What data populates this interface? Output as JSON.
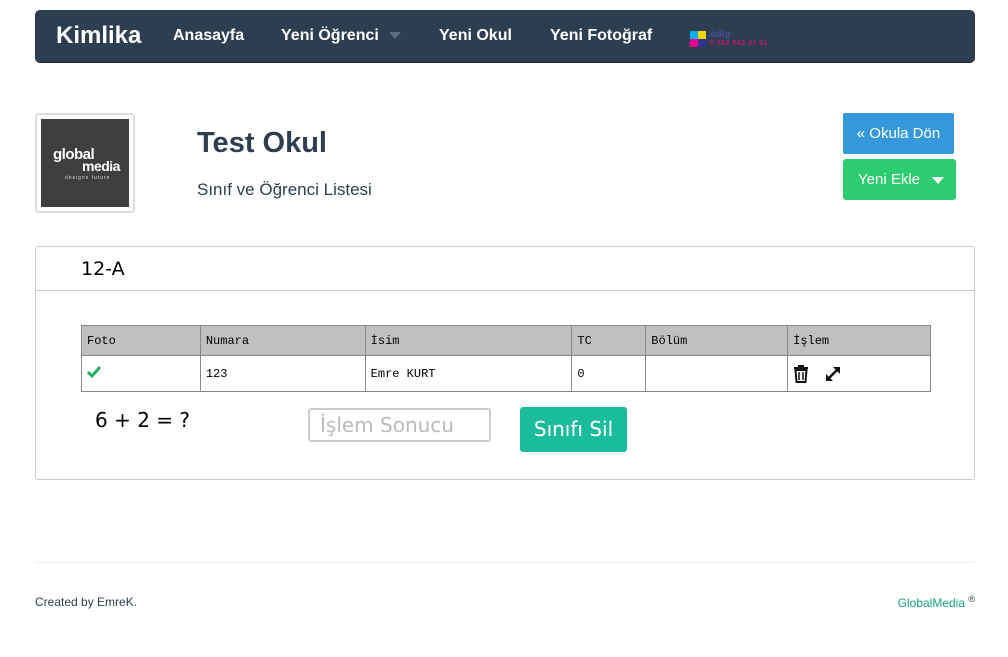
{
  "navbar": {
    "brand": "Kimlika",
    "items": [
      {
        "label": "Anasayfa"
      },
      {
        "label": "Yeni Öğrenci"
      },
      {
        "label": "Yeni Okul"
      },
      {
        "label": "Yeni Fotoğraf"
      }
    ],
    "ad_logo": {
      "name": "adig",
      "text": "adig",
      "subtext": "0 362 542 41 51"
    }
  },
  "school": {
    "logo_text_1": "global",
    "logo_text_2": "media",
    "logo_tagline": "designs future",
    "title": "Test Okul",
    "subtitle": "Sınıf ve Öğrenci Listesi"
  },
  "actions": {
    "back_label": "« Okula Dön",
    "add_label": "Yeni Ekle"
  },
  "class_panel": {
    "title": "12-A",
    "columns": [
      "Foto",
      "Numara",
      "İsim",
      "TC",
      "Bölüm",
      "İşlem"
    ],
    "rows": [
      {
        "photo": "check-icon",
        "number": "123",
        "name": "Emre KURT",
        "tc": "0",
        "department": ""
      }
    ],
    "captcha_question": "6 + 2 = ?",
    "result_placeholder": "İşlem Sonucu",
    "delete_label": "Sınıfı Sil"
  },
  "footer": {
    "left": "Created by EmreK.",
    "right": "GlobalMedia",
    "right_sup": "®"
  },
  "colors": {
    "navbar": "#2c3e50",
    "back_button": "#3498db",
    "add_button": "#2ecc71",
    "delete_button": "#1abc9c",
    "check": "#27ae60"
  }
}
